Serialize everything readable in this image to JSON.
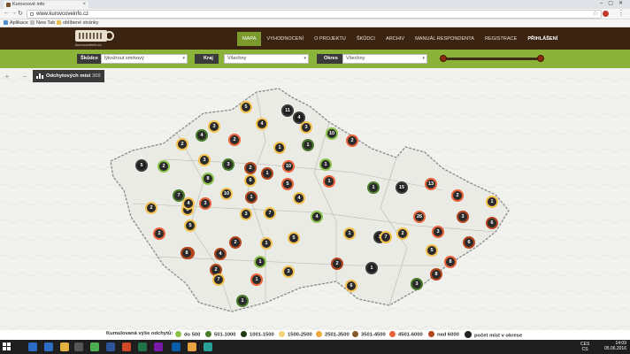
{
  "browser": {
    "tab_title": "Kurovcové info",
    "url": "www.kurovcoveinfo.cz",
    "bookmarks": [
      "Aplikace",
      "New Tab",
      "oblíbené stránky"
    ]
  },
  "site": {
    "logo_text": "kurovcoveinfo.cz",
    "nav": [
      {
        "label": "MAPA",
        "active": true
      },
      {
        "label": "VYHODNOCENÍ"
      },
      {
        "label": "O PROJEKTU"
      },
      {
        "label": "ŠKŮDCI"
      },
      {
        "label": "ARCHIV"
      },
      {
        "label": "MANUÁL RESPONDENTA"
      },
      {
        "label": "REGISTRACE"
      },
      {
        "label": "PŘIHLÁŠENÍ"
      }
    ]
  },
  "filters": {
    "skudce": {
      "label": "Škůdce",
      "value": "lýkožrout smrkový"
    },
    "kraj": {
      "label": "Kraj",
      "value": "Všechny"
    },
    "okres": {
      "label": "Okres",
      "value": "Všechny"
    }
  },
  "map": {
    "zoom_in": "+",
    "zoom_out": "−",
    "count_label": "Odchytových míst",
    "count_value": "368",
    "markers": [
      {
        "n": "5",
        "c": "#f2c14e"
      },
      {
        "n": "11",
        "c": "#3a3a3a"
      },
      {
        "n": "4",
        "c": "#3a3a3a"
      },
      {
        "n": "3",
        "c": "#f2c14e"
      },
      {
        "n": "4",
        "c": "#f2c14e"
      },
      {
        "n": "3",
        "c": "#f2c14e"
      },
      {
        "n": "10",
        "c": "#8bc34a"
      },
      {
        "n": "4",
        "c": "#4a7c2a"
      },
      {
        "n": "2",
        "c": "#e8623a"
      },
      {
        "n": "2",
        "c": "#e8623a"
      },
      {
        "n": "2",
        "c": "#f2c14e"
      },
      {
        "n": "1",
        "c": "#f2c14e"
      },
      {
        "n": "5",
        "c": "#3a3a3a"
      },
      {
        "n": "2",
        "c": "#8bc34a"
      },
      {
        "n": "3",
        "c": "#f2c14e"
      },
      {
        "n": "3",
        "c": "#4a7c2a"
      },
      {
        "n": "1",
        "c": "#8bc34a"
      },
      {
        "n": "1",
        "c": "#4a7c2a"
      },
      {
        "n": "2",
        "c": "#b5471f"
      },
      {
        "n": "10",
        "c": "#e8623a"
      },
      {
        "n": "8",
        "c": "#8bc34a"
      },
      {
        "n": "1",
        "c": "#b5471f"
      },
      {
        "n": "5",
        "c": "#e8623a"
      },
      {
        "n": "1",
        "c": "#e8623a"
      },
      {
        "n": "6",
        "c": "#f2c14e"
      },
      {
        "n": "7",
        "c": "#4a7c2a"
      },
      {
        "n": "10",
        "c": "#f2c14e"
      },
      {
        "n": "1",
        "c": "#b5471f"
      },
      {
        "n": "1",
        "c": "#4a7c2a"
      },
      {
        "n": "15",
        "c": "#3a3a3a"
      },
      {
        "n": "13",
        "c": "#e8623a"
      },
      {
        "n": "2",
        "c": "#e8623a"
      },
      {
        "n": "4",
        "c": "#f2c14e"
      },
      {
        "n": "1",
        "c": "#f2c14e"
      },
      {
        "n": "3",
        "c": "#e8623a"
      },
      {
        "n": "2",
        "c": "#f2c14e"
      },
      {
        "n": "3",
        "c": "#f2c14e"
      },
      {
        "n": "7",
        "c": "#f2c14e"
      },
      {
        "n": "4",
        "c": "#8bc34a"
      },
      {
        "n": "3",
        "c": "#f2c14e"
      },
      {
        "n": "1",
        "c": "#3a3a3a"
      },
      {
        "n": "26",
        "c": "#e8623a"
      },
      {
        "n": "3",
        "c": "#b5471f"
      },
      {
        "n": "6",
        "c": "#b5471f"
      },
      {
        "n": "5",
        "c": "#f2c14e"
      },
      {
        "n": "2",
        "c": "#e8623a"
      },
      {
        "n": "1",
        "c": "#f2c14e"
      },
      {
        "n": "2",
        "c": "#f2c14e"
      },
      {
        "n": "3",
        "c": "#e8623a"
      },
      {
        "n": "5",
        "c": "#f2c14e"
      },
      {
        "n": "7",
        "c": "#b5471f"
      },
      {
        "n": "2",
        "c": "#b5471f"
      },
      {
        "n": "1",
        "c": "#f2c14e"
      },
      {
        "n": "4",
        "c": "#b5471f"
      },
      {
        "n": "5",
        "c": "#f2c14e"
      },
      {
        "n": "6",
        "c": "#b5471f"
      },
      {
        "n": "8",
        "c": "#e8623a"
      },
      {
        "n": "1",
        "c": "#8bc34a"
      },
      {
        "n": "2",
        "c": "#b5471f"
      },
      {
        "n": "1",
        "c": "#3a3a3a"
      },
      {
        "n": "2",
        "c": "#b5471f"
      },
      {
        "n": "3",
        "c": "#f2c14e"
      },
      {
        "n": "8",
        "c": "#b5471f"
      },
      {
        "n": "1",
        "c": "#e8623a"
      },
      {
        "n": "7",
        "c": "#f2c14e"
      },
      {
        "n": "3",
        "c": "#4a7c2a"
      },
      {
        "n": "6",
        "c": "#f2c14e"
      },
      {
        "n": "1",
        "c": "#4a7c2a"
      },
      {
        "n": "4",
        "c": "#f2c14e"
      },
      {
        "n": "8",
        "c": "#b5471f"
      },
      {
        "n": "7",
        "c": "#f2c14e"
      }
    ]
  },
  "legend": {
    "title": "Kumulovaná výše odchytů:",
    "items": [
      {
        "label": "do 500",
        "color": "#8bc34a"
      },
      {
        "label": "501-1000",
        "color": "#4a7c2a"
      },
      {
        "label": "1001-1500",
        "color": "#1f3a12"
      },
      {
        "label": "1500-2500",
        "color": "#f7d17a"
      },
      {
        "label": "2501-3500",
        "color": "#f2a93b"
      },
      {
        "label": "3501-4500",
        "color": "#8a5a2a"
      },
      {
        "label": "4501-6000",
        "color": "#e8623a"
      },
      {
        "label": "nad 6000",
        "color": "#b5471f"
      }
    ],
    "pin_label": "počet míst v okrese"
  },
  "taskbar": {
    "lang": "CES\nCS",
    "time": "14:09",
    "date": "05.06.2016"
  }
}
